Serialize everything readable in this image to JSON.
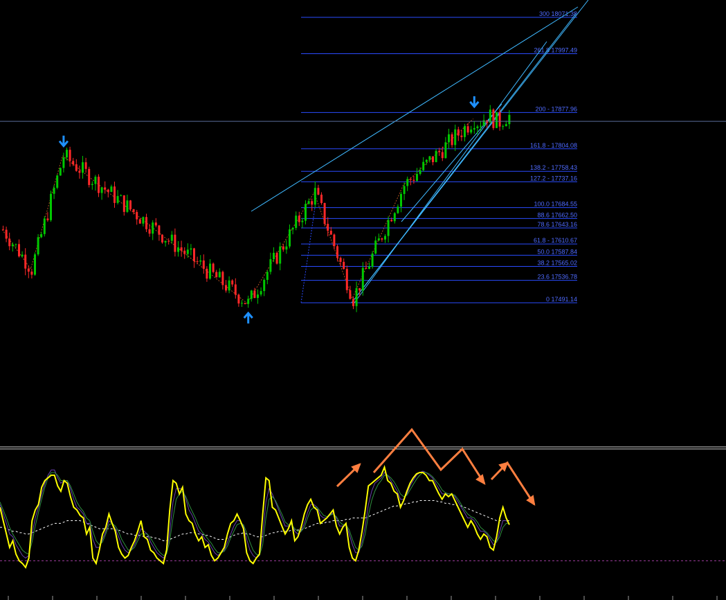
{
  "chart_data": [
    {
      "type": "candlestick",
      "title": "",
      "price_ylim": [
        17395,
        18090
      ],
      "current_price": 17860,
      "fibonacci_levels": [
        {
          "label": "300 18071.38",
          "ratio": 300,
          "price": 18071.38
        },
        {
          "label": "261.8 17997.49",
          "ratio": 261.8,
          "price": 17997.49
        },
        {
          "label": "200 - 17877.96",
          "ratio": 200,
          "price": 17877.96
        },
        {
          "label": "161.8 - 17804.08",
          "ratio": 161.8,
          "price": 17804.08
        },
        {
          "label": "138.2 - 17758.43",
          "ratio": 138.2,
          "price": 17758.43
        },
        {
          "label": "127.2 - 17737.16",
          "ratio": 127.2,
          "price": 17737.16
        },
        {
          "label": "100.0 17684.55",
          "ratio": 100.0,
          "price": 17684.55
        },
        {
          "label": "88.6 17662.50",
          "ratio": 88.6,
          "price": 17662.5
        },
        {
          "label": "78.6 17643.16",
          "ratio": 78.6,
          "price": 17643.16
        },
        {
          "label": "61.8 - 17610.67",
          "ratio": 61.8,
          "price": 17610.67
        },
        {
          "label": "50.0 17587.84",
          "ratio": 50.0,
          "price": 17587.84
        },
        {
          "label": "38.2 17565.02",
          "ratio": 38.2,
          "price": 17565.02
        },
        {
          "label": "23.6 17536.78",
          "ratio": 23.6,
          "price": 17536.78
        },
        {
          "label": "0 17491.14",
          "ratio": 0,
          "price": 17491.14
        }
      ],
      "candle_count": 160,
      "zigzag_pivots": [
        {
          "bar": 0,
          "price": 17640
        },
        {
          "bar": 9,
          "price": 17560
        },
        {
          "bar": 19,
          "price": 17790
        },
        {
          "bar": 77,
          "price": 17490
        },
        {
          "bar": 98,
          "price": 17715
        },
        {
          "bar": 110,
          "price": 17500
        },
        {
          "bar": 126,
          "price": 17730
        },
        {
          "bar": 148,
          "price": 17865
        }
      ],
      "fractal_arrows": [
        {
          "bar": 19,
          "direction": "down",
          "price": 17800
        },
        {
          "bar": 77,
          "direction": "up",
          "price": 17480
        },
        {
          "bar": 148,
          "direction": "down",
          "price": 17880
        }
      ],
      "colors": {
        "bull": "#00c800",
        "bear": "#ff2828",
        "fib": "#2a4bff",
        "fib_text": "#4f6bff",
        "trendline": "#3fb8ff",
        "zigzag": "#b05020",
        "arrow": "#1e90ff",
        "separator": "#d0d0d0"
      }
    },
    {
      "type": "line",
      "title": "",
      "ylim": [
        0,
        100
      ],
      "reference_level": 20,
      "series": [
        {
          "color": "#ffff00",
          "values": [
            60,
            50,
            40,
            30,
            35,
            25,
            20,
            18,
            15,
            22,
            50,
            58,
            62,
            75,
            80,
            82,
            84,
            84,
            76,
            72,
            80,
            78,
            68,
            60,
            58,
            54,
            52,
            40,
            45,
            22,
            18,
            28,
            40,
            45,
            55,
            48,
            42,
            30,
            25,
            22,
            24,
            30,
            35,
            42,
            50,
            38,
            36,
            28,
            26,
            22,
            20,
            18,
            28,
            58,
            80,
            78,
            70,
            75,
            55,
            50,
            48,
            40,
            35,
            38,
            30,
            32,
            24,
            20,
            22,
            26,
            30,
            40,
            48,
            50,
            55,
            50,
            44,
            26,
            20,
            18,
            22,
            25,
            55,
            82,
            80,
            60,
            58,
            52,
            46,
            40,
            44,
            50,
            35,
            38,
            45,
            55,
            62,
            66,
            60,
            58,
            48,
            50,
            52,
            55,
            58,
            46,
            40,
            45,
            48,
            30,
            22,
            20,
            28,
            42,
            58,
            76,
            78,
            80,
            82,
            84,
            90,
            80,
            78,
            72,
            70,
            60,
            65,
            72,
            78,
            82,
            85,
            86,
            86,
            84,
            80,
            80,
            75,
            70,
            66,
            70,
            68,
            70,
            65,
            60,
            55,
            50,
            45,
            50,
            46,
            40,
            36,
            40,
            38,
            30,
            28,
            38,
            52,
            60,
            52,
            47
          ]
        },
        {
          "color": "#6a3fb0",
          "values": [
            62,
            55,
            48,
            40,
            38,
            32,
            28,
            24,
            22,
            24,
            40,
            52,
            60,
            70,
            78,
            84,
            88,
            88,
            82,
            78,
            80,
            80,
            74,
            66,
            60,
            58,
            55,
            48,
            48,
            36,
            30,
            30,
            36,
            42,
            50,
            48,
            44,
            38,
            32,
            28,
            26,
            28,
            32,
            38,
            44,
            42,
            40,
            34,
            30,
            26,
            24,
            22,
            26,
            42,
            64,
            74,
            74,
            74,
            66,
            58,
            54,
            48,
            42,
            40,
            36,
            34,
            30,
            26,
            24,
            26,
            28,
            34,
            40,
            46,
            50,
            50,
            46,
            36,
            28,
            24,
            22,
            24,
            40,
            64,
            74,
            70,
            64,
            58,
            52,
            46,
            46,
            48,
            42,
            40,
            42,
            48,
            56,
            62,
            62,
            60,
            54,
            52,
            52,
            54,
            56,
            52,
            46,
            46,
            47,
            40,
            32,
            26,
            26,
            34,
            46,
            62,
            72,
            78,
            80,
            82,
            86,
            84,
            80,
            76,
            72,
            66,
            66,
            70,
            76,
            80,
            84,
            86,
            87,
            86,
            84,
            82,
            78,
            74,
            70,
            70,
            70,
            70,
            68,
            64,
            60,
            56,
            52,
            52,
            50,
            46,
            42,
            42,
            40,
            36,
            32,
            34,
            42,
            50,
            50,
            48
          ]
        },
        {
          "color": "#2f8f3f",
          "values": [
            64,
            58,
            52,
            45,
            40,
            36,
            32,
            28,
            26,
            25,
            34,
            46,
            56,
            66,
            75,
            82,
            86,
            86,
            84,
            80,
            80,
            80,
            76,
            70,
            64,
            60,
            57,
            52,
            50,
            42,
            35,
            32,
            34,
            40,
            47,
            48,
            46,
            42,
            36,
            32,
            28,
            28,
            30,
            35,
            40,
            40,
            40,
            37,
            33,
            29,
            26,
            24,
            25,
            35,
            52,
            66,
            70,
            72,
            68,
            62,
            57,
            52,
            46,
            42,
            39,
            36,
            33,
            29,
            26,
            26,
            27,
            31,
            37,
            42,
            47,
            48,
            47,
            41,
            34,
            28,
            25,
            24,
            32,
            52,
            66,
            68,
            65,
            60,
            55,
            49,
            47,
            47,
            44,
            42,
            42,
            45,
            52,
            58,
            60,
            60,
            57,
            54,
            53,
            54,
            55,
            53,
            49,
            47,
            47,
            43,
            36,
            30,
            28,
            31,
            40,
            54,
            65,
            72,
            77,
            80,
            84,
            84,
            82,
            79,
            75,
            70,
            68,
            69,
            73,
            77,
            81,
            84,
            86,
            86,
            85,
            83,
            80,
            77,
            73,
            71,
            70,
            70,
            69,
            66,
            62,
            58,
            55,
            53,
            52,
            49,
            45,
            43,
            41,
            38,
            35,
            34,
            38,
            45,
            48,
            48
          ]
        },
        {
          "color": "#ffffff",
          "dash": true,
          "values": [
            45,
            45,
            44,
            43,
            42,
            42,
            41,
            41,
            40,
            40,
            41,
            42,
            43,
            44,
            45,
            46,
            47,
            48,
            48,
            48,
            49,
            50,
            50,
            50,
            50,
            50,
            49,
            48,
            47,
            46,
            45,
            44,
            44,
            44,
            44,
            44,
            43,
            43,
            42,
            41,
            40,
            40,
            39,
            39,
            39,
            38,
            38,
            38,
            37,
            37,
            36,
            35,
            35,
            36,
            37,
            38,
            39,
            40,
            40,
            41,
            41,
            41,
            40,
            40,
            39,
            39,
            38,
            37,
            36,
            36,
            36,
            37,
            38,
            39,
            40,
            40,
            41,
            40,
            40,
            39,
            38,
            38,
            38,
            39,
            40,
            41,
            41,
            42,
            42,
            42,
            42,
            43,
            43,
            43,
            43,
            44,
            45,
            46,
            47,
            48,
            48,
            48,
            49,
            49,
            50,
            50,
            50,
            50,
            51,
            51,
            52,
            52,
            52,
            52,
            52,
            53,
            54,
            55,
            56,
            57,
            58,
            59,
            60,
            61,
            61,
            62,
            62,
            63,
            63,
            64,
            64,
            65,
            65,
            65,
            65,
            65,
            65,
            64,
            64,
            63,
            63,
            62,
            62,
            61,
            61,
            60,
            59,
            58,
            57,
            56,
            55,
            54,
            53,
            52,
            51,
            50,
            50,
            50,
            50,
            50
          ]
        }
      ],
      "annotation_arrows": [
        {
          "color": "#ff7f40"
        }
      ]
    }
  ]
}
